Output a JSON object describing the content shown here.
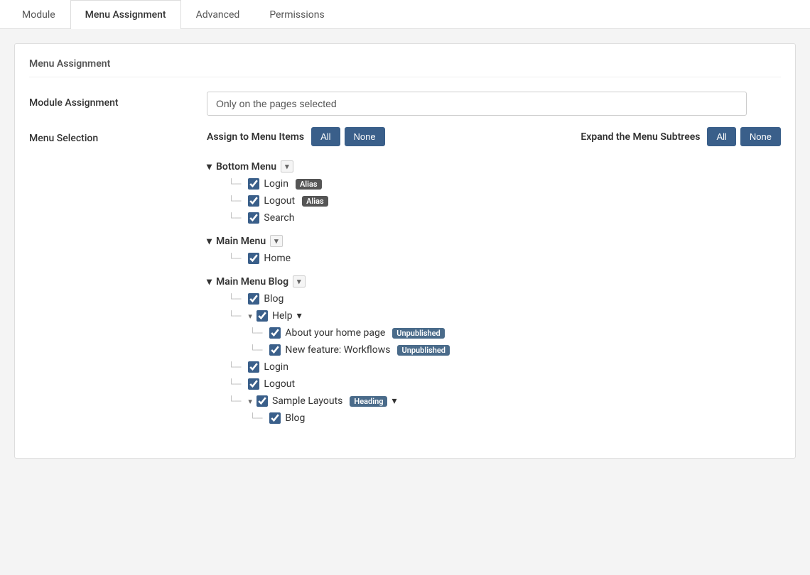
{
  "tabs": [
    {
      "id": "module",
      "label": "Module",
      "active": false
    },
    {
      "id": "menu-assignment",
      "label": "Menu Assignment",
      "active": true
    },
    {
      "id": "advanced",
      "label": "Advanced",
      "active": false
    },
    {
      "id": "permissions",
      "label": "Permissions",
      "active": false
    }
  ],
  "section": {
    "title": "Menu Assignment",
    "module_assignment_label": "Module Assignment",
    "module_assignment_value": "Only on the pages selected",
    "menu_selection_label": "Menu Selection"
  },
  "assign": {
    "assign_label": "Assign to Menu Items",
    "all_label": "All",
    "none_label": "None",
    "expand_label": "Expand the Menu Subtrees",
    "expand_all_label": "All",
    "expand_none_label": "None"
  },
  "menus": [
    {
      "id": "bottom-menu",
      "name": "Bottom Menu",
      "checked": false,
      "items": [
        {
          "id": "login",
          "label": "Login",
          "checked": true,
          "badge": "Alias",
          "badge_type": "alias",
          "children": []
        },
        {
          "id": "logout",
          "label": "Logout",
          "checked": true,
          "badge": "Alias",
          "badge_type": "alias",
          "children": []
        },
        {
          "id": "search",
          "label": "Search",
          "checked": true,
          "badge": null,
          "badge_type": null,
          "children": []
        }
      ]
    },
    {
      "id": "main-menu",
      "name": "Main Menu",
      "checked": false,
      "items": [
        {
          "id": "home",
          "label": "Home",
          "checked": true,
          "badge": null,
          "badge_type": null,
          "children": []
        }
      ]
    },
    {
      "id": "main-menu-blog",
      "name": "Main Menu Blog",
      "checked": false,
      "items": [
        {
          "id": "blog",
          "label": "Blog",
          "checked": true,
          "badge": null,
          "badge_type": null,
          "children": []
        },
        {
          "id": "help",
          "label": "Help",
          "checked": true,
          "badge": null,
          "badge_type": null,
          "children": [
            {
              "id": "about-home",
              "label": "About your home page",
              "checked": true,
              "badge": "Unpublished",
              "badge_type": "unpublished"
            },
            {
              "id": "new-feature",
              "label": "New feature: Workflows",
              "checked": true,
              "badge": "Unpublished",
              "badge_type": "unpublished"
            }
          ]
        },
        {
          "id": "login2",
          "label": "Login",
          "checked": true,
          "badge": null,
          "badge_type": null,
          "children": []
        },
        {
          "id": "logout2",
          "label": "Logout",
          "checked": true,
          "badge": null,
          "badge_type": null,
          "children": []
        },
        {
          "id": "sample-layouts",
          "label": "Sample Layouts",
          "checked": true,
          "badge": "Heading",
          "badge_type": "heading",
          "children": [
            {
              "id": "blog2",
              "label": "Blog",
              "checked": true,
              "badge": null,
              "badge_type": null
            }
          ]
        }
      ]
    }
  ]
}
